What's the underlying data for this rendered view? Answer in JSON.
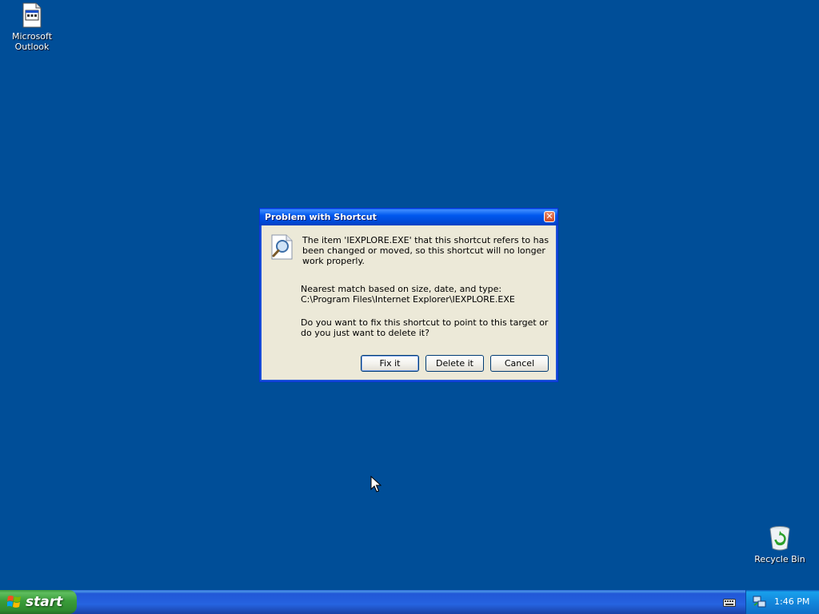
{
  "desktop": {
    "icons": [
      {
        "label": "Microsoft Outlook",
        "icon": "outlook-shortcut-icon"
      },
      {
        "label": "Recycle Bin",
        "icon": "recycle-bin-icon"
      }
    ]
  },
  "dialog": {
    "title": "Problem with Shortcut",
    "message": "The item 'IEXPLORE.EXE' that this shortcut refers to has been changed or moved, so this shortcut will no longer work properly.",
    "nearest_label": "Nearest match based on size, date, and type:",
    "nearest_path": "C:\\Program Files\\Internet Explorer\\IEXPLORE.EXE",
    "question": "Do you want to fix this shortcut to point to this target or do you just want to delete it?",
    "buttons": {
      "fix": "Fix it",
      "delete": "Delete it",
      "cancel": "Cancel"
    },
    "close_glyph": "✕"
  },
  "taskbar": {
    "start_label": "start",
    "clock": "1:46 PM"
  },
  "colors": {
    "desktop": "#004E98",
    "titlebar": "#0058EE",
    "taskbar": "#2663E0",
    "start": "#3A9D3A"
  }
}
